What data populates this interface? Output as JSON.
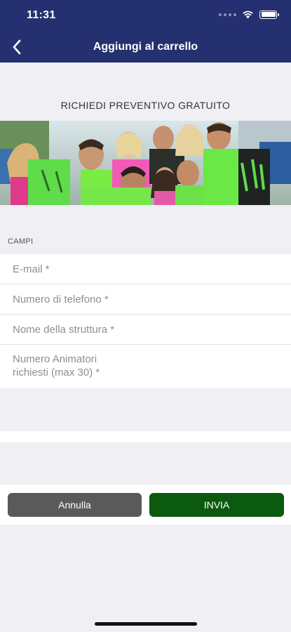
{
  "status_bar": {
    "time": "11:31"
  },
  "nav": {
    "title": "Aggiungi al carrello",
    "back_icon": "chevron-left-icon"
  },
  "page": {
    "quote_title": "RICHIEDI PREVENTIVO GRATUITO"
  },
  "banner": {
    "description_icon": "group-photo"
  },
  "form": {
    "section_label": "CAMPI",
    "fields": [
      {
        "label": "E-mail *"
      },
      {
        "label": "Numero di telefono *"
      },
      {
        "label": "Nome della struttura *"
      },
      {
        "label_line1": "Numero Animatori",
        "label_line2": "richiesti (max 30) *"
      }
    ]
  },
  "buttons": {
    "cancel_label": "Annulla",
    "send_label": "INVIA"
  },
  "colors": {
    "header": "#24306f",
    "send_button": "#0b5a0f",
    "cancel_button": "#5a5a5a",
    "background": "#efeff4"
  }
}
